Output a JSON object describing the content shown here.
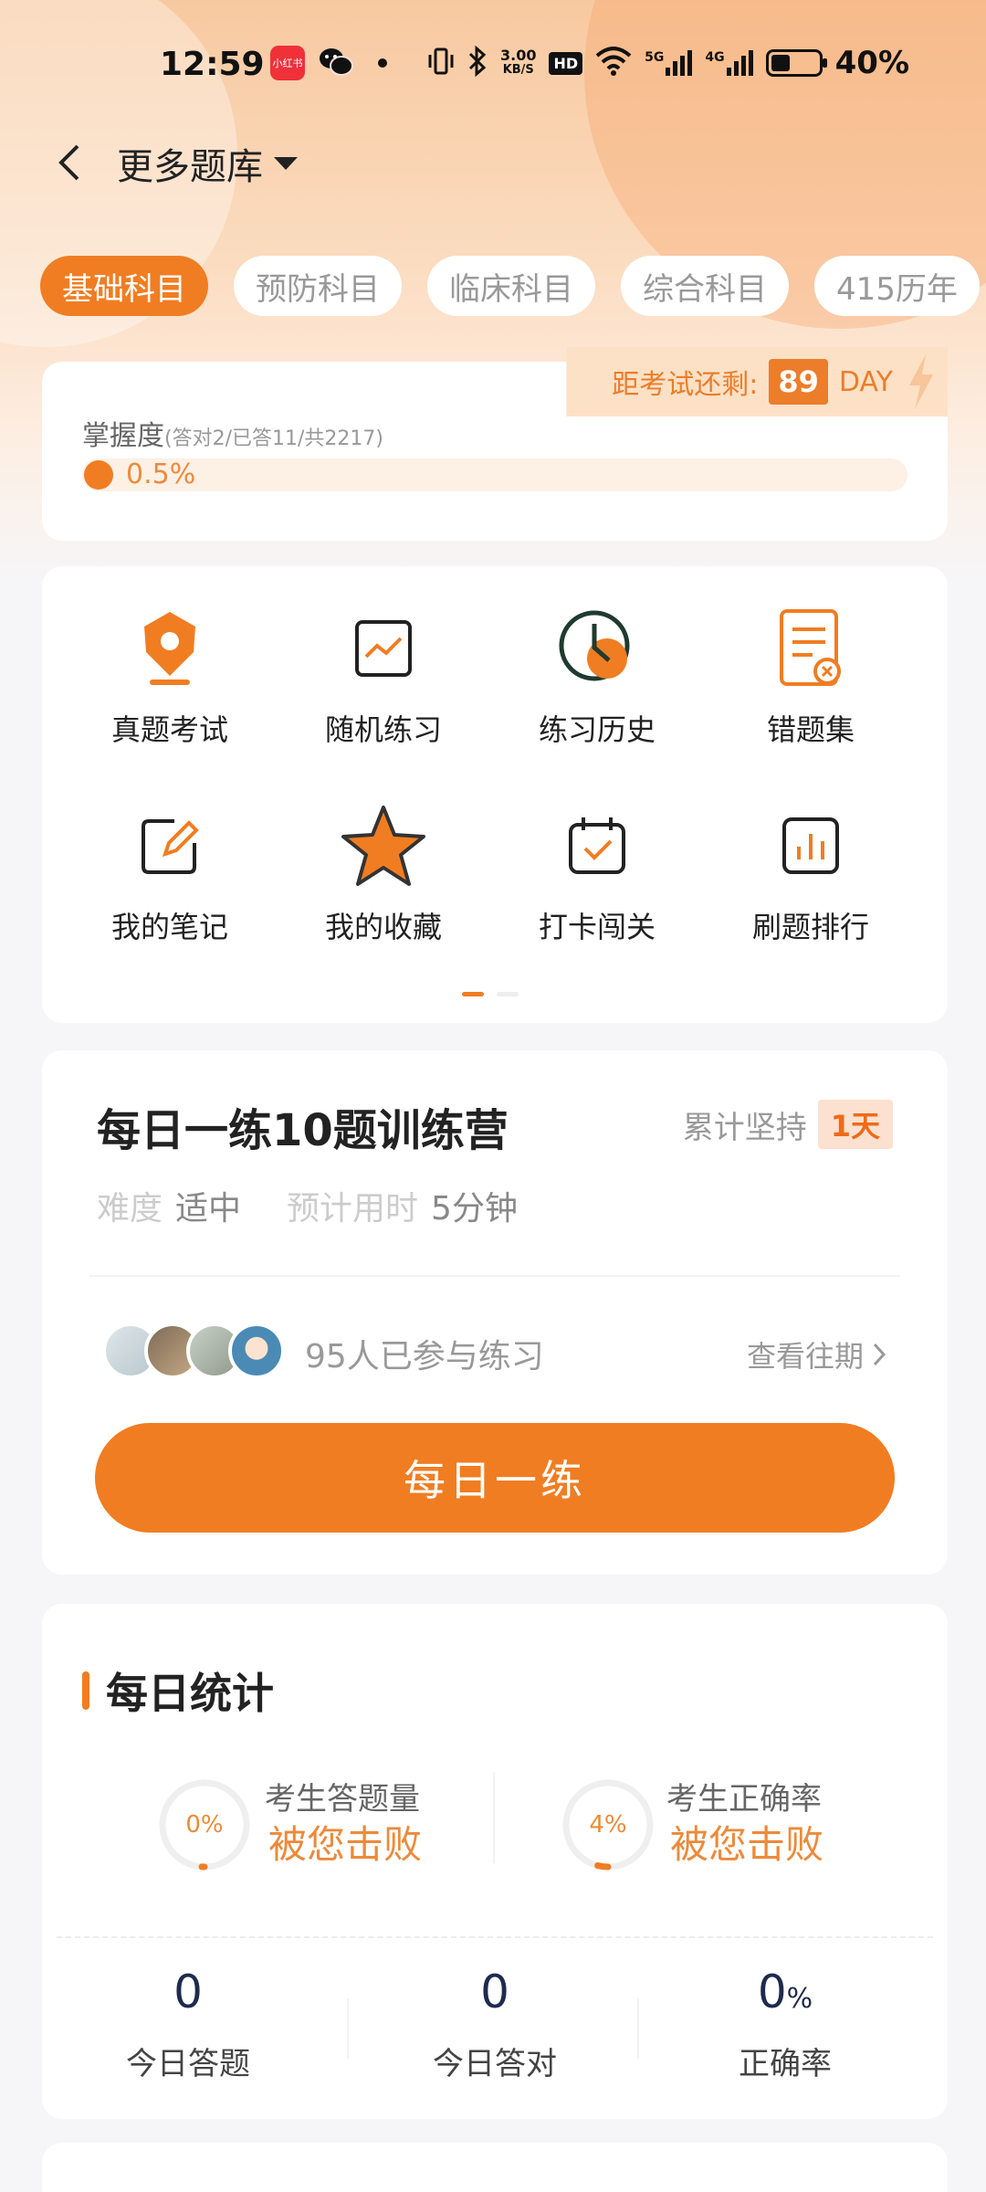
{
  "status_bar": {
    "time": "12:59",
    "app_badge": "小红书",
    "speed_value": "3.00",
    "speed_unit": "KB/S",
    "hd_label": "HD",
    "net1": "5G",
    "net2": "4G",
    "battery_text": "40%",
    "battery_level": 0.4
  },
  "header": {
    "title": "更多题库"
  },
  "tabs": [
    {
      "label": "基础科目",
      "active": true
    },
    {
      "label": "预防科目",
      "active": false
    },
    {
      "label": "临床科目",
      "active": false
    },
    {
      "label": "综合科目",
      "active": false
    },
    {
      "label": "415历年",
      "active": false
    }
  ],
  "mastery": {
    "countdown_label": "距考试还剩:",
    "countdown_days": "89",
    "countdown_unit": "DAY",
    "label": "掌握度",
    "detail": "(答对2/已答11/共2217)",
    "percent_text": "0.5%",
    "percent": 0.5
  },
  "grid": [
    {
      "label": "真题考试",
      "icon": "exam-pin-icon"
    },
    {
      "label": "随机练习",
      "icon": "chart-line-icon"
    },
    {
      "label": "练习历史",
      "icon": "clock-icon"
    },
    {
      "label": "错题集",
      "icon": "error-doc-icon"
    },
    {
      "label": "我的笔记",
      "icon": "note-edit-icon"
    },
    {
      "label": "我的收藏",
      "icon": "star-icon"
    },
    {
      "label": "打卡闯关",
      "icon": "calendar-check-icon"
    },
    {
      "label": "刷题排行",
      "icon": "bar-chart-icon"
    }
  ],
  "daily": {
    "title": "每日一练10题训练营",
    "persist_label": "累计坚持",
    "persist_value": "1天",
    "difficulty_label": "难度",
    "difficulty_value": "适中",
    "time_label": "预计用时",
    "time_value": "5分钟",
    "participants": "95人已参与练习",
    "history_link": "查看往期",
    "button": "每日一练"
  },
  "stats": {
    "title": "每日统计",
    "beat1": {
      "pct_text": "0%",
      "pct": 0,
      "label": "考生答题量",
      "strong": "被您击败"
    },
    "beat2": {
      "pct_text": "4%",
      "pct": 4,
      "label": "考生正确率",
      "strong": "被您击败"
    },
    "cols": [
      {
        "num": "0",
        "unit": "",
        "label": "今日答题"
      },
      {
        "num": "0",
        "unit": "",
        "label": "今日答对"
      },
      {
        "num": "0",
        "unit": "%",
        "label": "正确率"
      }
    ]
  },
  "colors": {
    "accent": "#f07d22",
    "accent_light": "#fde1c6"
  }
}
